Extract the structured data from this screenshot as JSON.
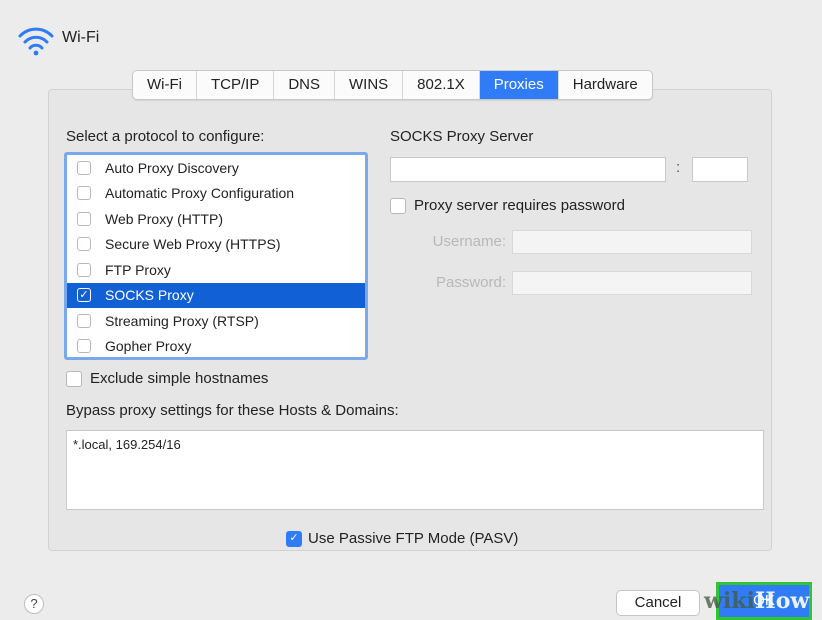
{
  "window": {
    "title": "Wi-Fi"
  },
  "tabs": [
    {
      "label": "Wi-Fi"
    },
    {
      "label": "TCP/IP"
    },
    {
      "label": "DNS"
    },
    {
      "label": "WINS"
    },
    {
      "label": "802.1X"
    },
    {
      "label": "Proxies",
      "active": true
    },
    {
      "label": "Hardware"
    }
  ],
  "protocols": {
    "heading": "Select a protocol to configure:",
    "items": [
      {
        "label": "Auto Proxy Discovery",
        "checked": false
      },
      {
        "label": "Automatic Proxy Configuration",
        "checked": false
      },
      {
        "label": "Web Proxy (HTTP)",
        "checked": false
      },
      {
        "label": "Secure Web Proxy (HTTPS)",
        "checked": false
      },
      {
        "label": "FTP Proxy",
        "checked": false
      },
      {
        "label": "SOCKS Proxy",
        "checked": true,
        "selected": true
      },
      {
        "label": "Streaming Proxy (RTSP)",
        "checked": false
      },
      {
        "label": "Gopher Proxy",
        "checked": false
      }
    ]
  },
  "proxy_server": {
    "heading": "SOCKS Proxy Server",
    "server_value": "",
    "colon": ":",
    "port_value": "",
    "requires_password_label": "Proxy server requires password",
    "requires_password_checked": false,
    "username_label": "Username:",
    "username_value": "",
    "password_label": "Password:",
    "password_value": ""
  },
  "exclude_simple": {
    "label": "Exclude simple hostnames",
    "checked": false
  },
  "bypass": {
    "label": "Bypass proxy settings for these Hosts & Domains:",
    "value": "*.local, 169.254/16"
  },
  "passive_ftp": {
    "label": "Use Passive FTP Mode (PASV)",
    "checked": true
  },
  "footer": {
    "help": "?",
    "cancel_label": "Cancel",
    "ok_label": "OK"
  },
  "watermark": {
    "wiki": "wiki",
    "how": "How"
  },
  "colors": {
    "accent": "#2f7cf6",
    "selection": "#1160d6",
    "focus_ring": "#7aa8ec",
    "highlight_outline": "#33c433"
  },
  "icons": {
    "wifi": "wifi-icon",
    "checkmark": "checkmark-icon",
    "help": "question-icon"
  }
}
